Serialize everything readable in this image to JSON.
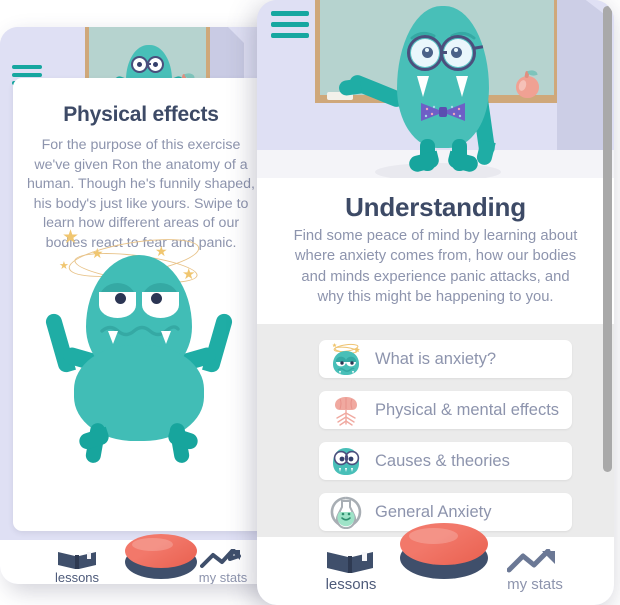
{
  "app": {
    "accent_teal": "#17a7a0",
    "accent_red": "#ed6b5a",
    "bg_lavender": "#dfe0f4",
    "text_dark": "#3d4a66",
    "text_muted": "#8d94ad",
    "list_bg": "#ebebeb"
  },
  "left_phone": {
    "menu_icon": "hamburger-menu-icon",
    "scene": {
      "chalkboard_label": "chalkboard",
      "apple_icon": "apple-icon",
      "eraser_icon": "eraser-icon",
      "character_icon": "teacher-monster-icon"
    },
    "card": {
      "title": "Physical effects",
      "body": "For the purpose of this exercise we've given Ron the anatomy of a human. Though he's funnily shaped, his body's just like yours. Swipe to learn how different areas of our bodies react to fear and panic."
    },
    "illustration": {
      "name": "dizzy-monster-illustration",
      "stars": 5
    },
    "bottom_nav": {
      "lessons_label": "lessons",
      "lessons_icon": "open-book-icon",
      "center_button_icon": "big-red-panic-button",
      "stats_label": "my stats",
      "stats_icon": "trend-arrow-icon"
    }
  },
  "right_phone": {
    "menu_icon": "hamburger-menu-icon",
    "scene": {
      "chalkboard_label": "chalkboard",
      "apple_icon": "apple-icon",
      "eraser_icon": "eraser-icon",
      "character_icon": "teacher-monster-with-glasses-and-bowtie"
    },
    "card": {
      "title": "Understanding",
      "body": "Find some peace of mind by learning about where anxiety comes from, how our bodies and minds experience panic attacks, and why this might be happening to you."
    },
    "lessons": [
      {
        "label": "What is anxiety?",
        "icon": "dizzy-monster-icon"
      },
      {
        "label": "Physical & mental effects",
        "icon": "brain-icon"
      },
      {
        "label": "Causes & theories",
        "icon": "glasses-monster-icon"
      },
      {
        "label": "General Anxiety",
        "icon": "flask-smiley-icon"
      }
    ],
    "scrollbar": {
      "name": "vertical-scrollbar"
    },
    "bottom_nav": {
      "lessons_label": "lessons",
      "lessons_icon": "open-book-icon",
      "center_button_icon": "big-red-panic-button",
      "stats_label": "my stats",
      "stats_icon": "trend-arrow-icon"
    }
  }
}
